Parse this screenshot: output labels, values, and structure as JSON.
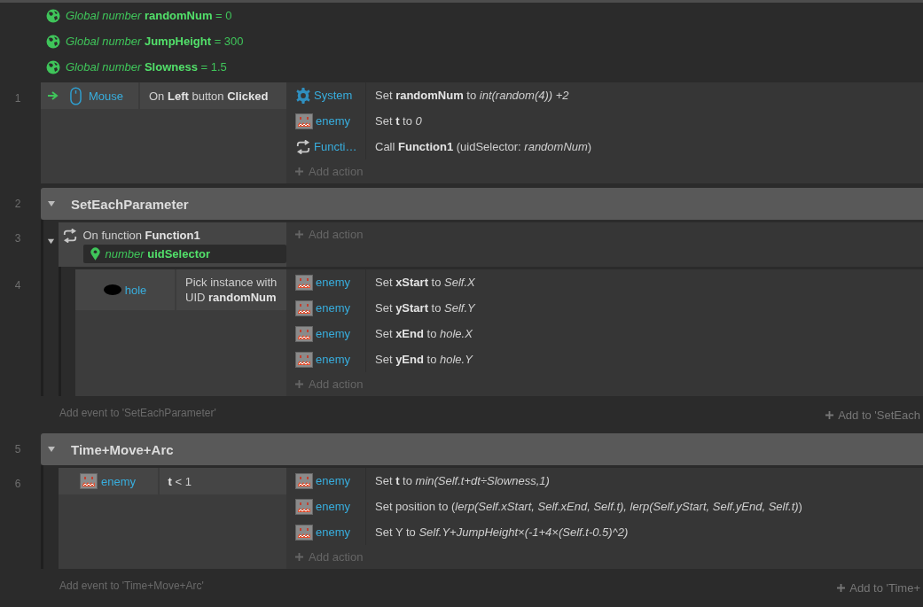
{
  "globals": [
    {
      "text": "*Global number* **randomNum** = 0"
    },
    {
      "text": "*Global number* **JumpHeight** = 300"
    },
    {
      "text": "*Global number* **Slowness** = 1.5"
    }
  ],
  "rows": [
    {
      "kind": "event",
      "number": "1",
      "conditions": [
        {
          "kind": "object",
          "trigger": true,
          "object": {
            "kind": "mouse",
            "name": "Mouse"
          },
          "text": "On **Left** button **Clicked**"
        }
      ],
      "actions": [
        {
          "object": {
            "kind": "system",
            "name": "System"
          },
          "text": "Set **randomNum** to *int(random(4)) +2*"
        },
        {
          "object": {
            "kind": "character",
            "name": "enemy"
          },
          "text": "Set **t** to *0*"
        },
        {
          "object": {
            "kind": "function",
            "name": "Functi…"
          },
          "text": "Call **Function1** (uidSelector: *randomNum*)"
        }
      ],
      "add_action": "Add action"
    },
    {
      "kind": "group",
      "number": "2",
      "title": "SetEachParameter",
      "expanded": true,
      "events": [
        {
          "number": "3",
          "expanded": true,
          "conditions": [
            {
              "kind": "function",
              "text": "On function **Function1**",
              "params": [
                "*number* **uidSelector**"
              ]
            }
          ],
          "add_action": "Add action",
          "children": [
            {
              "number": "4",
              "conditions": [
                {
                  "kind": "object",
                  "trigger": false,
                  "object": {
                    "kind": "shape",
                    "name": "hole"
                  },
                  "text": "Pick instance with UID **randomNum**"
                }
              ],
              "actions": [
                {
                  "object": {
                    "kind": "character",
                    "name": "enemy"
                  },
                  "text": "Set **xStart** to *Self.X*"
                },
                {
                  "object": {
                    "kind": "character",
                    "name": "enemy"
                  },
                  "text": "Set **yStart** to *Self.Y*"
                },
                {
                  "object": {
                    "kind": "character",
                    "name": "enemy"
                  },
                  "text": "Set **xEnd** to *hole.X*"
                },
                {
                  "object": {
                    "kind": "character",
                    "name": "enemy"
                  },
                  "text": "Set **yEnd** to *hole.Y*"
                }
              ],
              "add_action": "Add action"
            }
          ]
        }
      ],
      "add_event": "Add event to 'SetEachParameter'",
      "add_to": "Add to 'SetEach"
    },
    {
      "kind": "group",
      "number": "5",
      "title": "Time+Move+Arc",
      "expanded": true,
      "events": [
        {
          "number": "6",
          "conditions": [
            {
              "kind": "object",
              "trigger": false,
              "object": {
                "kind": "character",
                "name": "enemy"
              },
              "text": "**t** < 1"
            }
          ],
          "actions": [
            {
              "object": {
                "kind": "character",
                "name": "enemy"
              },
              "text": "Set **t** to *min(Self.t+dt÷Slowness,1)*"
            },
            {
              "object": {
                "kind": "character",
                "name": "enemy"
              },
              "text": "Set position to (*lerp(Self.xStart, Self.xEnd, Self.t), lerp(Self.yStart, Self.yEnd, Self.t)*)"
            },
            {
              "object": {
                "kind": "character",
                "name": "enemy"
              },
              "text": "Set Y to *Self.Y+JumpHeight×(-1+4×(Self.t-0.5)^2)*"
            }
          ],
          "add_action": "Add action"
        }
      ],
      "add_event": "Add event to 'Time+Move+Arc'",
      "add_to": "Add to 'Time+"
    }
  ]
}
